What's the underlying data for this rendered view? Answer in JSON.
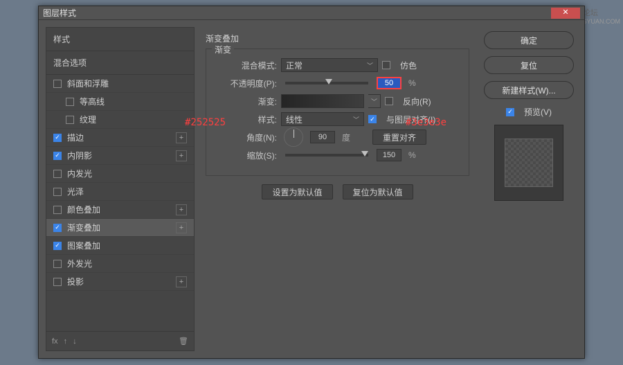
{
  "dialog_title": "图层样式",
  "watermark": {
    "line1": "思缘设计论坛",
    "line2": "WWW.MISSYUAN.COM"
  },
  "left": {
    "header": "样式",
    "sub": "混合选项",
    "items": [
      {
        "label": "斜面和浮雕",
        "checked": false,
        "plus": false,
        "indent": false
      },
      {
        "label": "等高线",
        "checked": false,
        "plus": false,
        "indent": true
      },
      {
        "label": "纹理",
        "checked": false,
        "plus": false,
        "indent": true
      },
      {
        "label": "描边",
        "checked": true,
        "plus": true,
        "indent": false
      },
      {
        "label": "内阴影",
        "checked": true,
        "plus": true,
        "indent": false
      },
      {
        "label": "内发光",
        "checked": false,
        "plus": false,
        "indent": false
      },
      {
        "label": "光泽",
        "checked": false,
        "plus": false,
        "indent": false
      },
      {
        "label": "颜色叠加",
        "checked": false,
        "plus": true,
        "indent": false
      },
      {
        "label": "渐变叠加",
        "checked": true,
        "plus": true,
        "indent": false,
        "selected": true
      },
      {
        "label": "图案叠加",
        "checked": true,
        "plus": false,
        "indent": false
      },
      {
        "label": "外发光",
        "checked": false,
        "plus": false,
        "indent": false
      },
      {
        "label": "投影",
        "checked": false,
        "plus": true,
        "indent": false
      }
    ]
  },
  "center": {
    "section_title": "渐变叠加",
    "fieldset_label": "渐变",
    "blend_label": "混合模式:",
    "blend_value": "正常",
    "dither_label": "仿色",
    "opacity_label": "不透明度(P):",
    "opacity_value": "50",
    "opacity_unit": "%",
    "gradient_label": "渐变:",
    "reverse_label": "反向(R)",
    "style_label": "样式:",
    "style_value": "线性",
    "align_label": "与图层对齐(I)",
    "angle_label": "角度(N):",
    "angle_value": "90",
    "angle_unit": "度",
    "reset_align": "重置对齐",
    "scale_label": "缩放(S):",
    "scale_value": "150",
    "scale_unit": "%",
    "set_default": "设置为默认值",
    "reset_default": "复位为默认值"
  },
  "right": {
    "ok": "确定",
    "cancel": "复位",
    "new_style": "新建样式(W)...",
    "preview_label": "预览(V)"
  },
  "annotations": {
    "left_color": "#252525",
    "right_color": "#3e3e3e"
  }
}
